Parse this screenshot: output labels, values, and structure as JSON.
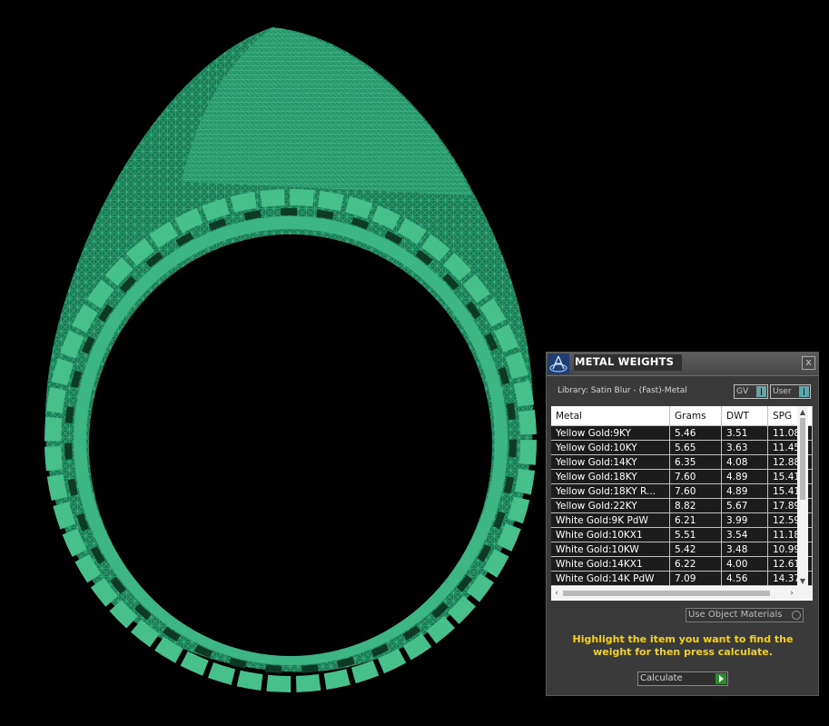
{
  "viewport": {
    "model": "ring-wireframe-model",
    "wire_color": "#2aa070"
  },
  "panel": {
    "title": "METAL WEIGHTS",
    "close_glyph": "x",
    "library_label": "Library: Satin Blur - (Fast)-Metal",
    "toggles": {
      "gv": "GV",
      "user": "User"
    },
    "table": {
      "headers": [
        "Metal",
        "Grams",
        "DWT",
        "SPG"
      ],
      "rows": [
        [
          "Yellow Gold:9KY",
          "5.46",
          "3.51",
          "11.08"
        ],
        [
          "Yellow Gold:10KY",
          "5.65",
          "3.63",
          "11.45"
        ],
        [
          "Yellow Gold:14KY",
          "6.35",
          "4.08",
          "12.88"
        ],
        [
          "Yellow Gold:18KY",
          "7.60",
          "4.89",
          "15.41"
        ],
        [
          "Yellow Gold:18KY R...",
          "7.60",
          "4.89",
          "15.41"
        ],
        [
          "Yellow Gold:22KY",
          "8.82",
          "5.67",
          "17.89"
        ],
        [
          "White Gold:9K PdW",
          "6.21",
          "3.99",
          "12.59"
        ],
        [
          "White Gold:10KX1",
          "5.51",
          "3.54",
          "11.18"
        ],
        [
          "White Gold:10KW",
          "5.42",
          "3.48",
          "10.99"
        ],
        [
          "White Gold:14KX1",
          "6.22",
          "4.00",
          "12.61"
        ],
        [
          "White Gold:14K PdW",
          "7.09",
          "4.56",
          "14.37"
        ]
      ]
    },
    "use_object_materials": "Use Object Materials",
    "instructions": "Highlight the item you want to find the weight for then press calculate.",
    "calculate": "Calculate",
    "colors": {
      "panel_bg": "#3a3a3a",
      "highlight_text": "#f3d21c",
      "row_bg": "#1c1c1c"
    }
  }
}
